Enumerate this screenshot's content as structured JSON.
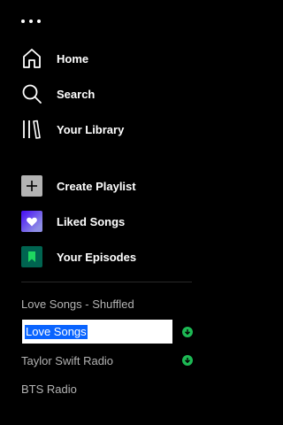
{
  "nav": {
    "home_label": "Home",
    "search_label": "Search",
    "library_label": "Your Library"
  },
  "actions": {
    "create_playlist_label": "Create Playlist",
    "liked_songs_label": "Liked Songs",
    "your_episodes_label": "Your Episodes"
  },
  "playlists": [
    {
      "name": "Love Songs - Shuffled",
      "downloaded": false
    },
    {
      "name": "Love Songs",
      "downloaded": true,
      "editing": true
    },
    {
      "name": "Taylor Swift Radio",
      "downloaded": true
    },
    {
      "name": "BTS Radio",
      "downloaded": false
    }
  ],
  "icons": {
    "menu": "more-dots-icon",
    "home": "home-icon",
    "search": "search-icon",
    "library": "library-icon",
    "create": "plus-icon",
    "liked": "heart-icon",
    "episodes": "bookmark-icon",
    "download": "download-arrow-icon"
  },
  "colors": {
    "background": "#000000",
    "text_active": "#ffffff",
    "text_muted": "#b3b3b3",
    "download_green": "#1db954",
    "selection_blue": "#0a64ff",
    "episodes_green": "#006450"
  }
}
